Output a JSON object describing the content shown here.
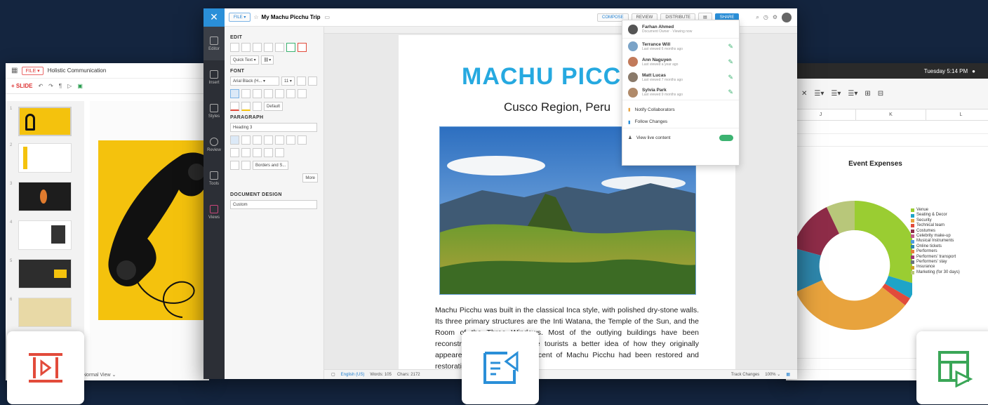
{
  "presentation": {
    "file_chip": "FILE ▾",
    "title": "Holistic Communication",
    "new_slide": "+ SLIDE",
    "view_label": "Normal View ⌄",
    "slide_numbers": [
      "1",
      "2",
      "3",
      "4",
      "5",
      "6"
    ]
  },
  "writer": {
    "file_chip": "FILE ▾",
    "doc_title": "My Machu Picchu Trip",
    "mode_tabs": [
      "COMPOSE",
      "REVIEW",
      "DISTRIBUTE"
    ],
    "share_label": "SHARE",
    "side_items": [
      "Editor",
      "Insert",
      "Styles",
      "Review",
      "Tools",
      "Views"
    ],
    "pane": {
      "edit_heading": "EDIT",
      "quick_text": "Quick Text ▾",
      "font_heading": "FONT",
      "font_name": "Arial Black (H... ▾",
      "font_size": "11 ▾",
      "default_btn": "Default",
      "paragraph_heading": "PARAGRAPH",
      "heading_style": "Heading 3",
      "borders_btn": "Borders and S...",
      "more_btn": "More",
      "design_heading": "DOCUMENT DESIGN",
      "design_value": "Custom"
    },
    "page": {
      "title": "MACHU PICC",
      "subtitle": "Cusco Region, Peru",
      "body": "Machu Picchu was built in the classical Inca style, with polished dry-stone walls. Its three primary structures are the Inti Watana, the Temple of the Sun, and the Room of the Three Windows. Most of the outlying buildings have been reconstructed in order to give tourists a better idea of how they originally appeared. By 1976, thirty percent of Machu Picchu had been restored and restoration continues."
    },
    "status": {
      "language": "English (US)",
      "words": "Words: 105",
      "chars": "Chars: 2172",
      "track": "Track Changes",
      "zoom": "100% ⌄"
    }
  },
  "collaborators": {
    "owner": {
      "name": "Farhan Ahmed",
      "sub": "Document Owner · Viewing now"
    },
    "users": [
      {
        "name": "Terrance Will",
        "sub": "Last viewed 6 months ago"
      },
      {
        "name": "Ann Naguyen",
        "sub": "Last viewed a year ago"
      },
      {
        "name": "Matt Lucas",
        "sub": "Last viewed 7 months ago"
      },
      {
        "name": "Sylvia Park",
        "sub": "Last viewed 9 months ago"
      }
    ],
    "notify": "Notify Collaborators",
    "follow": "Follow Changes",
    "view_live": "View live content"
  },
  "spreadsheet": {
    "clock": "Tuesday 5:14 PM",
    "columns": [
      "J",
      "K",
      "L"
    ],
    "chart_title": "Event Expenses",
    "legend": [
      {
        "label": "Venue",
        "color": "#9acd32"
      },
      {
        "label": "Seating & Decor",
        "color": "#1ea4c8"
      },
      {
        "label": "Security",
        "color": "#e8a33d"
      },
      {
        "label": "Technical team",
        "color": "#e14b3b"
      },
      {
        "label": "Costumes",
        "color": "#8e2c48"
      },
      {
        "label": "Celebrity make-up",
        "color": "#c05a8a"
      },
      {
        "label": "Musical Instruments",
        "color": "#4d9de0"
      },
      {
        "label": "Online tickets",
        "color": "#2e86ab"
      },
      {
        "label": "Performers",
        "color": "#e57f3a"
      },
      {
        "label": "Performers' transport",
        "color": "#a23b72"
      },
      {
        "label": "Performers' stay",
        "color": "#6c757d"
      },
      {
        "label": "Insurance",
        "color": "#c9a227"
      },
      {
        "label": "Marketing (for 30 days)",
        "color": "#b8c77a"
      }
    ]
  }
}
